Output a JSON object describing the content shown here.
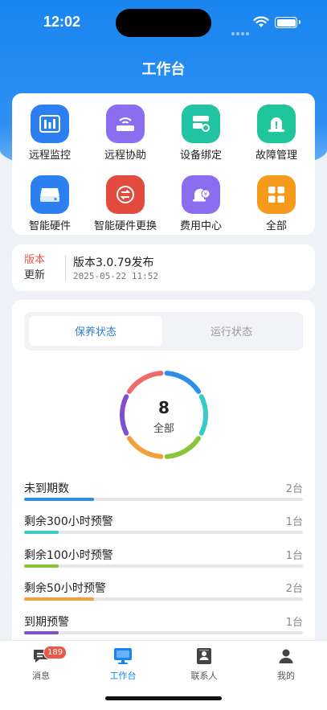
{
  "status_bar": {
    "time": "12:02"
  },
  "header": {
    "title": "工作台"
  },
  "grid": {
    "items": [
      {
        "label": "远程监控",
        "icon": "bar-chart-icon",
        "color": "#2b7ff0"
      },
      {
        "label": "远程协助",
        "icon": "router-icon",
        "color": "#8b6ef0"
      },
      {
        "label": "设备绑定",
        "icon": "link-device-icon",
        "color": "#21c3a2"
      },
      {
        "label": "故障管理",
        "icon": "alarm-icon",
        "color": "#1fc59b"
      },
      {
        "label": "智能硬件",
        "icon": "drive-icon",
        "color": "#2b7ff0"
      },
      {
        "label": "智能硬件更换",
        "icon": "swap-icon",
        "color": "#e34b3e"
      },
      {
        "label": "费用中心",
        "icon": "money-bell-icon",
        "color": "#8b6ef0"
      },
      {
        "label": "全部",
        "icon": "grid-icon",
        "color": "#f59a1c"
      }
    ]
  },
  "version": {
    "tag_line1": "版本",
    "tag_line2": "更新",
    "title": "版本3.0.79发布",
    "date": "2025-05-22 11:52"
  },
  "status": {
    "tabs": [
      {
        "label": "保养状态",
        "active": true
      },
      {
        "label": "运行状态",
        "active": false
      }
    ],
    "total": "8",
    "total_label": "全部",
    "rows": [
      {
        "label": "未到期数",
        "count": "2台",
        "color": "#2b8ee8",
        "fraction": 0.25
      },
      {
        "label": "剩余300小时预警",
        "count": "1台",
        "color": "#3cc9c9",
        "fraction": 0.125
      },
      {
        "label": "剩余100小时预警",
        "count": "1台",
        "color": "#8ac43a",
        "fraction": 0.125
      },
      {
        "label": "剩余50小时预警",
        "count": "2台",
        "color": "#f3a03b",
        "fraction": 0.25
      },
      {
        "label": "到期预警",
        "count": "1台",
        "color": "#7f4fd0",
        "fraction": 0.125
      }
    ],
    "ring_colors": [
      "#2b8ee8",
      "#3cc9c9",
      "#8ac43a",
      "#f3a03b",
      "#7f4fd0",
      "#f06a6a"
    ]
  },
  "tabbar": {
    "items": [
      {
        "label": "消息",
        "badge": "189"
      },
      {
        "label": "工作台"
      },
      {
        "label": "联系人"
      },
      {
        "label": "我的"
      }
    ],
    "active_color": "#1a86f0"
  }
}
